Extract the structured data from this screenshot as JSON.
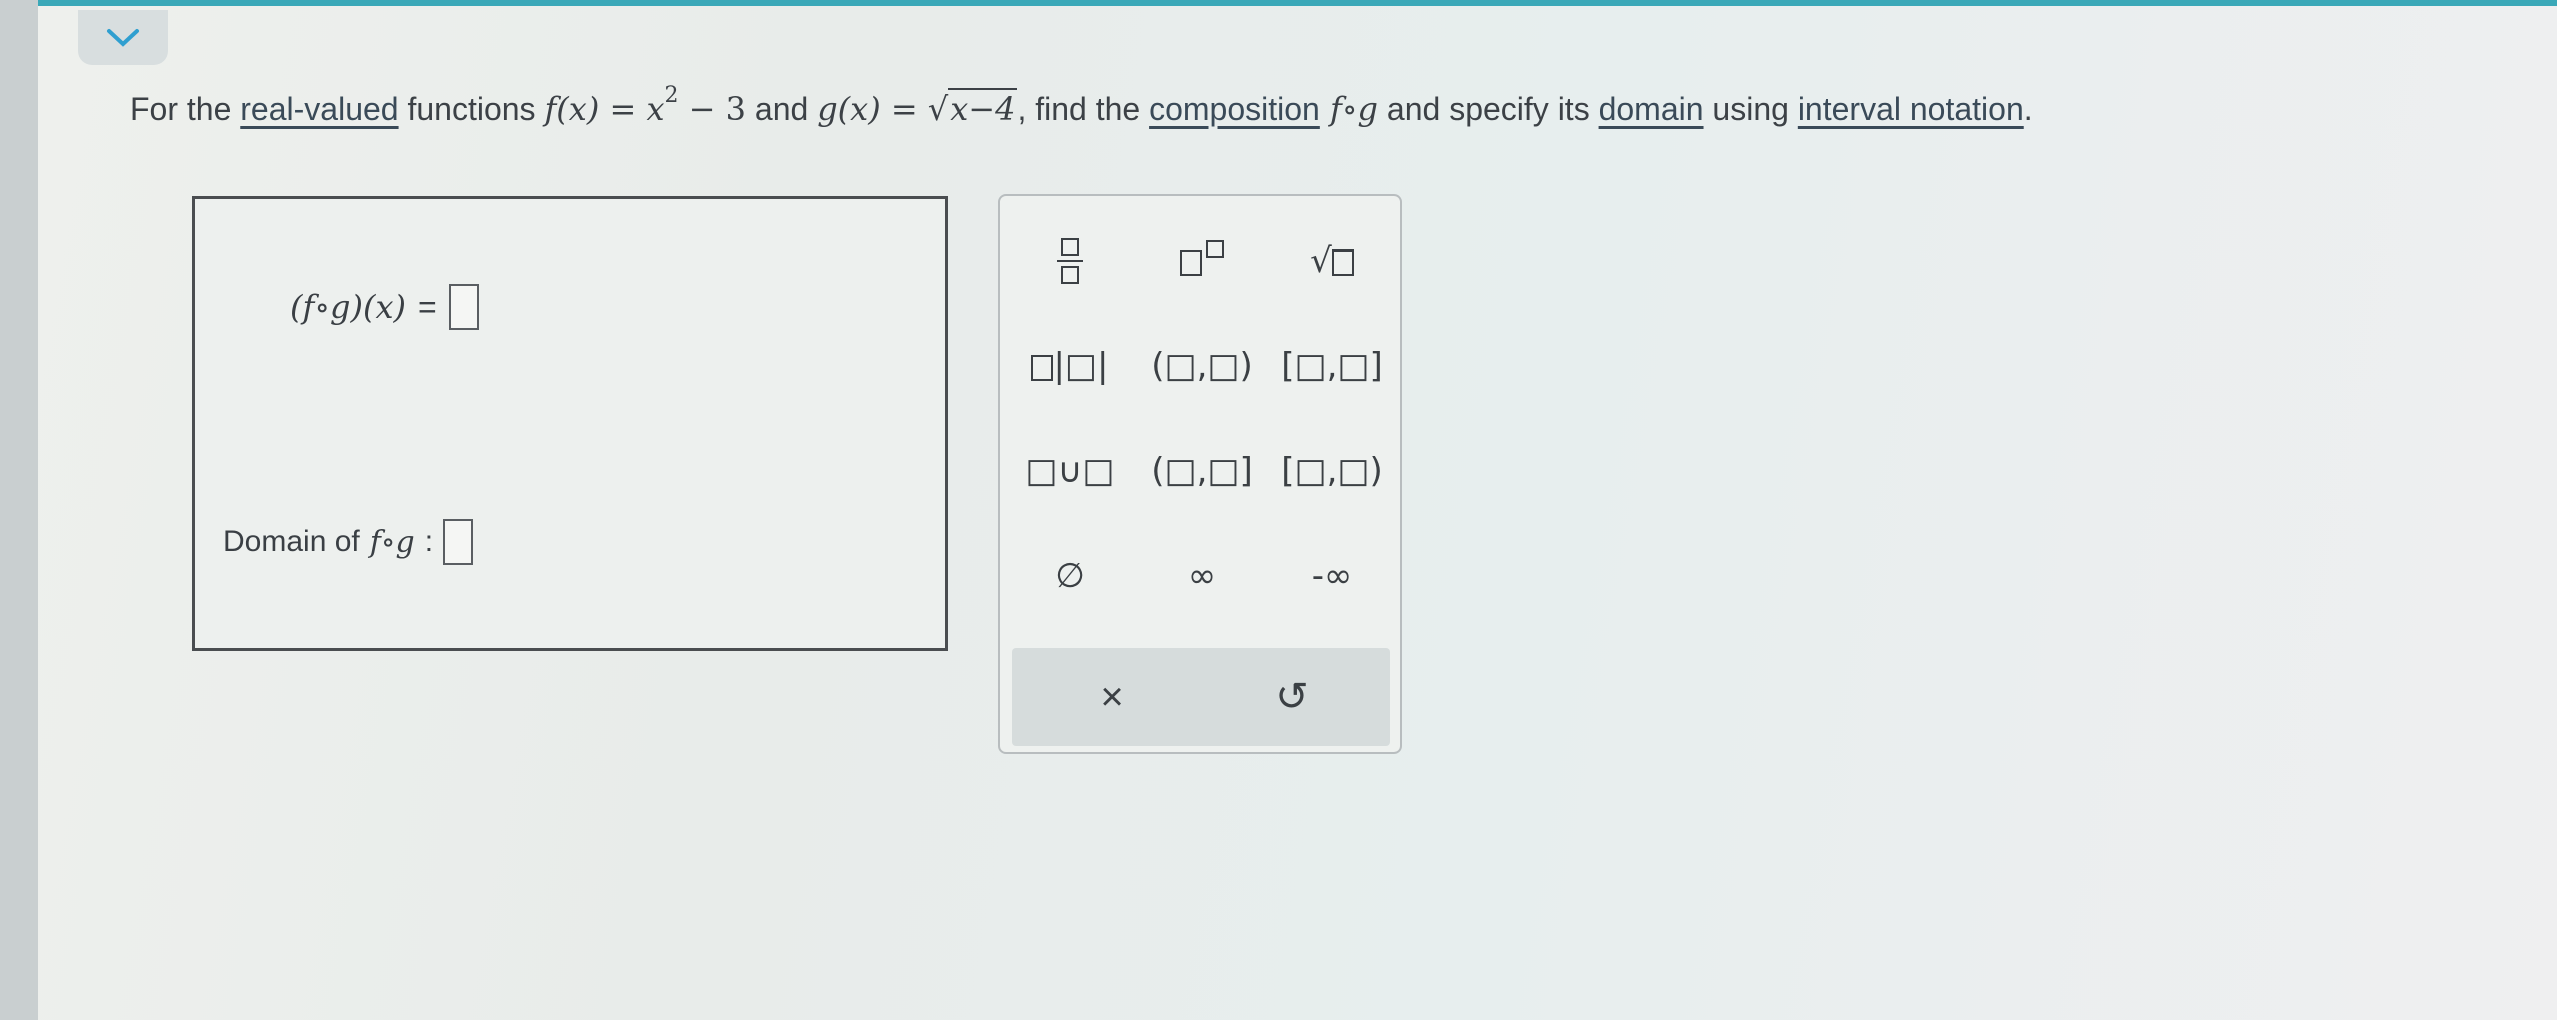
{
  "question": {
    "p1": "For the ",
    "link1": "real-valued",
    "p2": " functions ",
    "f_def": "f(x) = x",
    "f_exp": "2",
    "f_tail": " − 3",
    "p3": " and ",
    "g_def": "g(x) = ",
    "g_rad": "x−4",
    "p4": ", find the ",
    "link2": "composition",
    "fog": " f∘g",
    "p5": " and specify its ",
    "link3": "domain",
    "p6": " using ",
    "link4": "interval notation",
    "p7": "."
  },
  "answer": {
    "composition_label": "(f∘g)(x)",
    "equals": "=",
    "domain_label": "Domain of",
    "domain_fn": "f∘g",
    "colon": ":"
  },
  "palette": {
    "row2": [
      "|□|"
    ],
    "open_open": "(□,□)",
    "closed_closed": "[□,□]",
    "union": "□∪□",
    "open_closed": "(□,□]",
    "closed_open": "[□,□)",
    "empty_set": "∅",
    "infinity": "∞",
    "neg_infinity": "-∞",
    "clear": "×",
    "undo": "↺"
  }
}
